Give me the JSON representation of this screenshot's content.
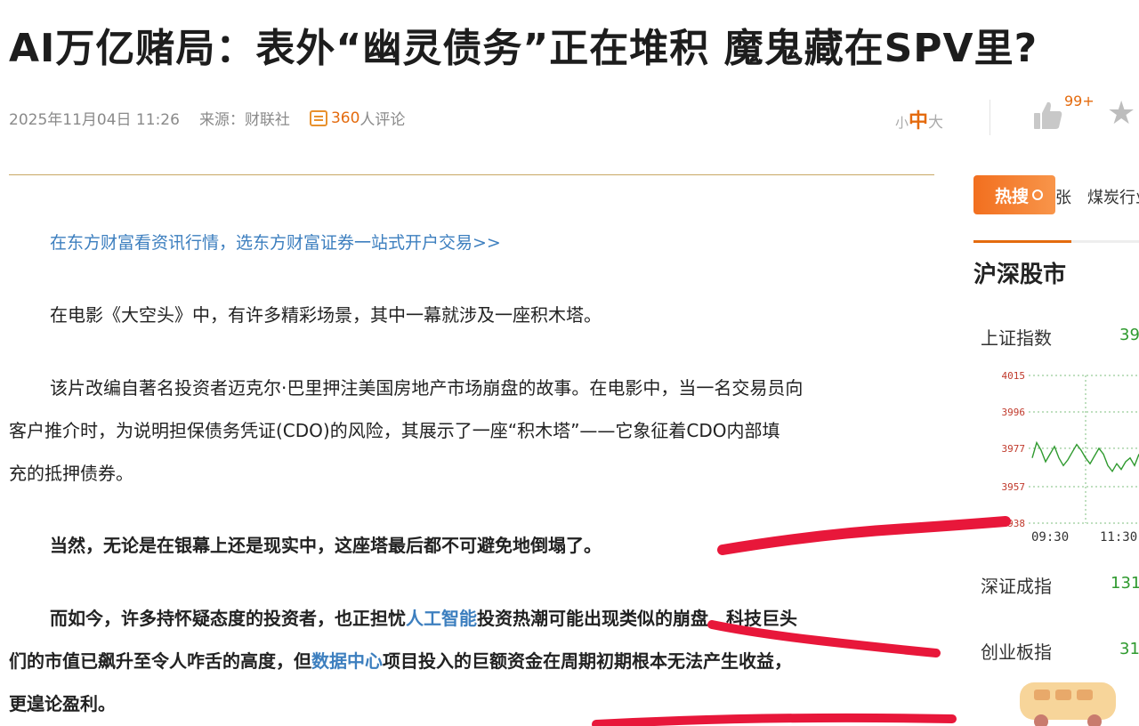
{
  "article": {
    "headline": "AI万亿赌局：表外“幽灵债务”正在堆积 魔鬼藏在SPV里?",
    "date": "2025年11月04日 11:26",
    "source_label": "来源：",
    "source_name": "财联社",
    "comment_count": "360",
    "comment_suffix": "人评论",
    "promo_link": "在东方财富看资讯行情，选东方财富证券一站式开户交易>>",
    "paragraphs": {
      "p1": "在电影《大空头》中，有许多精彩场景，其中一幕就涉及一座积木塔。",
      "p2_line1": "该片改编自著名投资者迈克尔·巴里押注美国房地产市场崩盘的故事。在电影中，当一名交易员向",
      "p2_line2": "客户推介时，为说明担保债务凭证(CDO)的风险，其展示了一座“积木塔”——它象征着CDO内部填",
      "p2_line3": "充的抵押债券。",
      "p3": "当然，无论是在银幕上还是现实中，这座塔最后都不可避免地倒塌了。",
      "p4_a": "而如今，许多持怀疑态度的投资者，也正担忧",
      "p4_link1": "人工智能",
      "p4_b": "投资热潮可能出现类似的崩盘。科技巨头",
      "p4_c": "们的市值已飙升至令人咋舌的高度，但",
      "p4_link2": "数据中心",
      "p4_d": "项目投入的巨额资金在周期初期根本无法产生收益，",
      "p4_e": "更遑论盈利。"
    }
  },
  "toolbar": {
    "font_small": "小",
    "font_medium": "中",
    "font_large": "大",
    "like_count": "99+"
  },
  "sidebar": {
    "hot_label": "热搜",
    "hot_ticker": "张　煤炭行业",
    "market_title": "沪深股市",
    "indices": [
      {
        "name": "上证指数",
        "value": "39"
      },
      {
        "name": "深证成指",
        "value": "131"
      },
      {
        "name": "创业板指",
        "value": "31"
      }
    ]
  },
  "chart_data": {
    "type": "line",
    "title": "",
    "x": [
      "09:30",
      "11:30"
    ],
    "yticks": [
      4015,
      3996,
      3977,
      3957,
      3938
    ],
    "ylim": [
      3938,
      4015
    ],
    "grid": true,
    "series": [
      {
        "color": "#2f9a2f",
        "values": [
          3972,
          3980,
          3976,
          3970,
          3974,
          3978,
          3972,
          3968,
          3971,
          3975,
          3979,
          3976,
          3972,
          3969,
          3973,
          3977,
          3974,
          3968,
          3965,
          3969,
          3966,
          3970,
          3972,
          3968,
          3974
        ]
      }
    ]
  },
  "colors": {
    "accent": "#e46b0e",
    "link": "#3d7fbf",
    "down": "#2f9a2f",
    "up": "#c0392b",
    "annotation": "#e8173a"
  }
}
